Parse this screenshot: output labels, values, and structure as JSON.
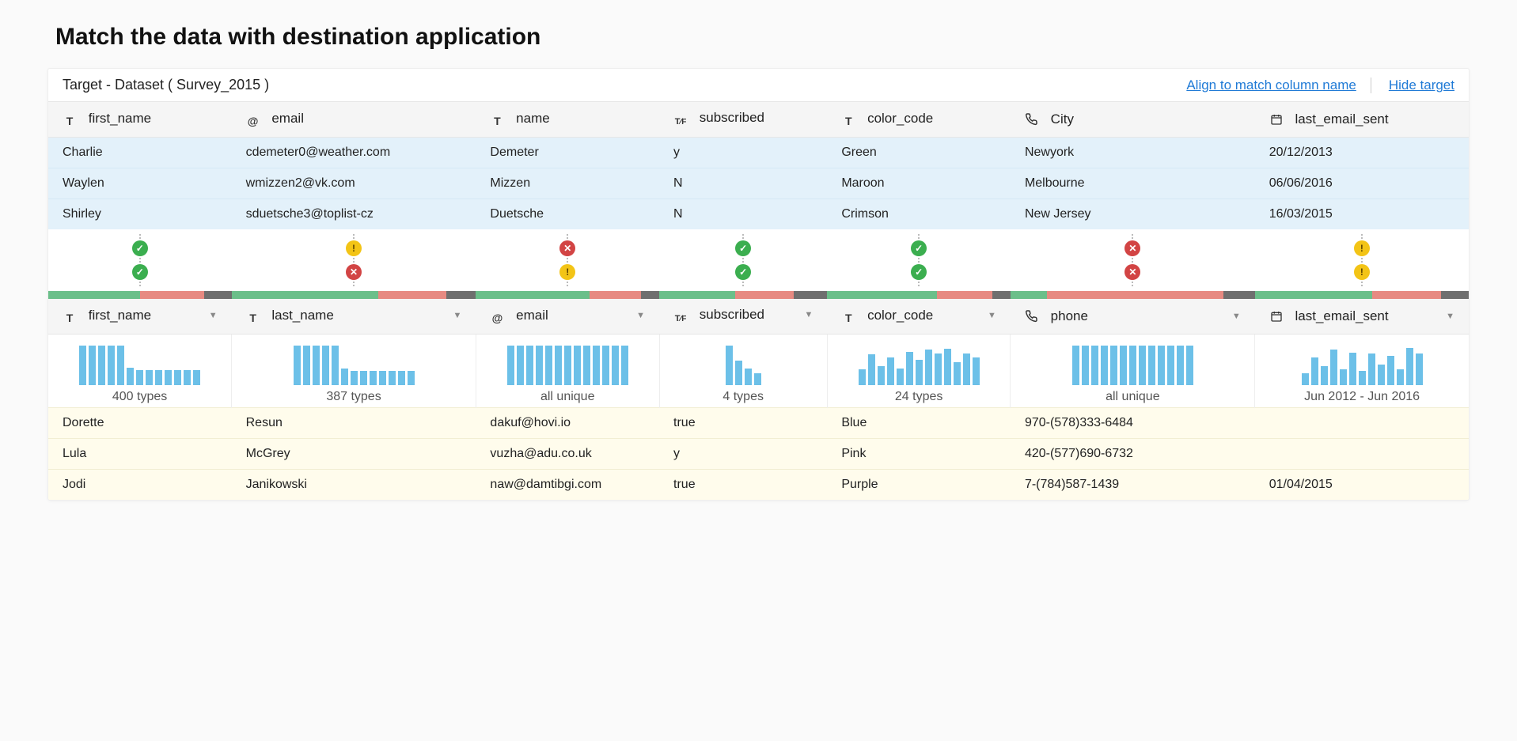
{
  "page_title": "Match the data with destination application",
  "topbar": {
    "target_label": "Target - Dataset ( Survey_2015 )",
    "align_link": "Align to match column name",
    "hide_link": "Hide target"
  },
  "target_columns": [
    {
      "type": "text",
      "label": "first_name"
    },
    {
      "type": "email",
      "label": "email"
    },
    {
      "type": "text",
      "label": "name"
    },
    {
      "type": "bool",
      "label": "subscribed"
    },
    {
      "type": "text",
      "label": "color_code"
    },
    {
      "type": "phone",
      "label": "City"
    },
    {
      "type": "date",
      "label": "last_email_sent"
    }
  ],
  "target_rows": [
    {
      "c": [
        "Charlie",
        "cdemeter0@weather.com",
        "Demeter",
        "y",
        "Green",
        "Newyork",
        "20/12/2013"
      ]
    },
    {
      "c": [
        "Waylen",
        "wmizzen2@vk.com",
        "Mizzen",
        "N",
        "Maroon",
        "Melbourne",
        "06/06/2016"
      ]
    },
    {
      "c": [
        "Shirley",
        "sduetsche3@toplist-cz",
        "Duetsche",
        "N",
        "Crimson",
        "New Jersey",
        "16/03/2015"
      ]
    }
  ],
  "status_top": [
    "ok",
    "warn",
    "err",
    "ok",
    "ok",
    "err",
    "warn"
  ],
  "status_bottom": [
    "ok",
    "err",
    "warn",
    "ok",
    "ok",
    "err",
    "warn"
  ],
  "segbars": [
    {
      "g": 50,
      "r": 35,
      "d": 15
    },
    {
      "g": 60,
      "r": 28,
      "d": 12
    },
    {
      "g": 62,
      "r": 28,
      "d": 10
    },
    {
      "g": 45,
      "r": 35,
      "d": 20
    },
    {
      "g": 60,
      "r": 30,
      "d": 10
    },
    {
      "g": 15,
      "r": 72,
      "d": 13
    },
    {
      "g": 55,
      "r": 32,
      "d": 13
    }
  ],
  "source_columns": [
    {
      "type": "text",
      "label": "first_name"
    },
    {
      "type": "text",
      "label": "last_name"
    },
    {
      "type": "email",
      "label": "email"
    },
    {
      "type": "bool",
      "label": "subscribed"
    },
    {
      "type": "text",
      "label": "color_code"
    },
    {
      "type": "phone",
      "label": "phone"
    },
    {
      "type": "date",
      "label": "last_email_sent"
    }
  ],
  "chart_data": [
    {
      "type": "bar",
      "values": [
        100,
        100,
        100,
        100,
        100,
        45,
        38,
        38,
        38,
        38,
        38,
        38,
        38
      ],
      "label": "400 types"
    },
    {
      "type": "bar",
      "values": [
        100,
        100,
        100,
        100,
        100,
        42,
        36,
        36,
        36,
        36,
        36,
        36,
        36
      ],
      "label": "387 types"
    },
    {
      "type": "bar",
      "values": [
        100,
        100,
        100,
        100,
        100,
        100,
        100,
        100,
        100,
        100,
        100,
        100,
        100
      ],
      "label": "all unique"
    },
    {
      "type": "bar",
      "values": [
        100,
        62,
        42,
        30
      ],
      "label": "4 types"
    },
    {
      "type": "bar",
      "values": [
        40,
        78,
        48,
        70,
        42,
        84,
        64,
        90,
        80,
        92,
        58,
        80,
        70
      ],
      "label": "24 types"
    },
    {
      "type": "bar",
      "values": [
        100,
        100,
        100,
        100,
        100,
        100,
        100,
        100,
        100,
        100,
        100,
        100,
        100
      ],
      "label": "all unique"
    },
    {
      "type": "bar",
      "values": [
        30,
        70,
        48,
        90,
        40,
        82,
        36,
        80,
        52,
        74,
        40,
        94,
        80
      ],
      "label": "Jun 2012 - Jun 2016"
    }
  ],
  "source_rows": [
    {
      "c": [
        "Dorette",
        "Resun",
        "dakuf@hovi.io",
        "true",
        "Blue",
        "970-(578)333-6484",
        ""
      ]
    },
    {
      "c": [
        "Lula",
        "McGrey",
        "vuzha@adu.co.uk",
        "y",
        "Pink",
        "420-(577)690-6732",
        ""
      ]
    },
    {
      "c": [
        "Jodi",
        "Janikowski",
        "naw@damtibgi.com",
        "true",
        "Purple",
        "7-(784)587-1439",
        "01/04/2015"
      ]
    }
  ]
}
